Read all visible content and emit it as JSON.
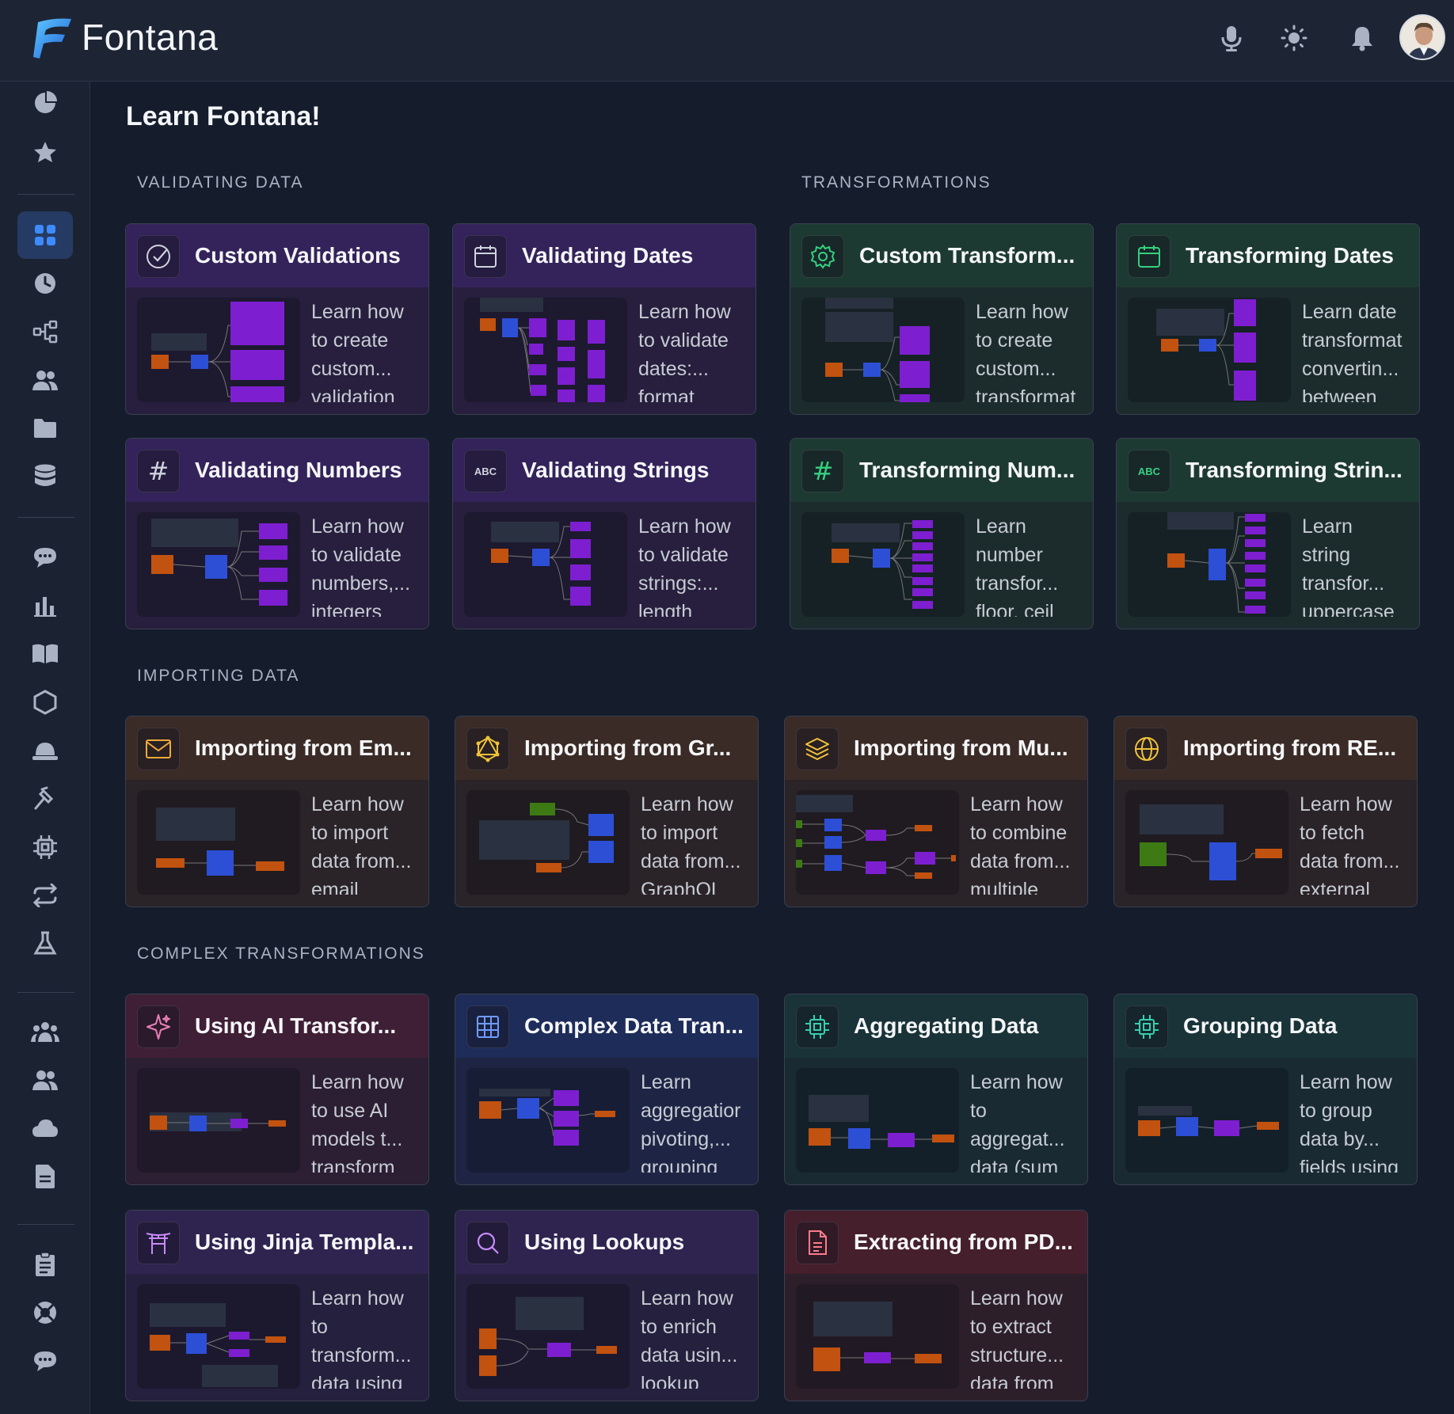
{
  "app": {
    "name": "Fontana"
  },
  "header": {
    "icons": [
      "microphone-icon",
      "sun-icon",
      "bell-icon",
      "avatar"
    ]
  },
  "sidebar": {
    "icons": [
      "pie-chart-icon",
      "star-icon",
      "grid-icon",
      "clock-icon",
      "flow-icon",
      "users-icon",
      "folder-icon",
      "database-icon",
      "chat-icon",
      "bar-chart-icon",
      "book-icon",
      "hexagon-icon",
      "hat-icon",
      "hammer-icon",
      "chip-icon",
      "repeat-icon",
      "flask-icon",
      "team-icon",
      "group-icon",
      "cloud-icon",
      "document-icon",
      "clipboard-icon",
      "support-icon",
      "message-icon"
    ],
    "active": "grid-icon"
  },
  "main": {
    "title": "Learn Fontana!",
    "sections": {
      "validating": "VALIDATING DATA",
      "transformations": "TRANSFORMATIONS",
      "importing": "IMPORTING DATA",
      "complex": "COMPLEX TRANSFORMATIONS"
    }
  },
  "cards": {
    "custom_validations": {
      "title": "Custom Validations",
      "icon": "check-circle-icon",
      "desc": [
        "Learn how",
        "to create",
        "custom...",
        "validation"
      ]
    },
    "validating_dates": {
      "title": "Validating Dates",
      "icon": "calendar-icon",
      "desc": [
        "Learn how",
        "to validate",
        "dates:...",
        "format"
      ]
    },
    "custom_transform": {
      "title": "Custom Transform...",
      "icon": "gear-icon",
      "desc": [
        "Learn how",
        "to create",
        "custom...",
        "transformat"
      ]
    },
    "transforming_dates": {
      "title": "Transforming Dates",
      "icon": "calendar-icon",
      "desc": [
        "Learn date",
        "transformat",
        "convertin...",
        "between"
      ]
    },
    "validating_numbers": {
      "title": "Validating Numbers",
      "icon": "hash-icon",
      "desc": [
        "Learn how",
        "to validate",
        "numbers,...",
        "integers"
      ]
    },
    "validating_strings": {
      "title": "Validating Strings",
      "icon": "abc-icon",
      "desc": [
        "Learn how",
        "to validate",
        "strings:...",
        "length"
      ]
    },
    "transforming_num": {
      "title": "Transforming Num...",
      "icon": "hash-icon",
      "desc": [
        "Learn",
        "number",
        "transfor...",
        "floor, ceil"
      ]
    },
    "transforming_strin": {
      "title": "Transforming Strin...",
      "icon": "abc-icon",
      "desc": [
        "Learn",
        "string",
        "transfor...",
        "uppercase"
      ]
    },
    "importing_em": {
      "title": "Importing from Em...",
      "icon": "mail-icon",
      "desc": [
        "Learn how",
        "to import",
        "data from...",
        "email"
      ]
    },
    "importing_gr": {
      "title": "Importing from Gr...",
      "icon": "graphql-icon",
      "desc": [
        "Learn how",
        "to import",
        "data from...",
        "GraphQL"
      ]
    },
    "importing_mu": {
      "title": "Importing from Mu...",
      "icon": "layers-icon",
      "desc": [
        "Learn how",
        "to combine",
        "data from...",
        "multiple"
      ]
    },
    "importing_re": {
      "title": "Importing from RE...",
      "icon": "globe-icon",
      "desc": [
        "Learn how",
        "to fetch",
        "data from...",
        "external"
      ]
    },
    "using_ai": {
      "title": "Using AI Transfor...",
      "icon": "sparkle-icon",
      "desc": [
        "Learn how",
        "to use AI",
        "models t...",
        "transform"
      ]
    },
    "complex_data": {
      "title": "Complex Data Tran...",
      "icon": "table-icon",
      "desc": [
        "Learn",
        "aggregatior",
        "pivoting,...",
        "grouping"
      ]
    },
    "aggregating": {
      "title": "Aggregating Data",
      "icon": "cpu-icon",
      "desc": [
        "Learn how",
        "to",
        "aggregat...",
        "data (sum"
      ]
    },
    "grouping": {
      "title": "Grouping Data",
      "icon": "cpu-icon",
      "desc": [
        "Learn how",
        "to group",
        "data by...",
        "fields using"
      ]
    },
    "jinja": {
      "title": "Using Jinja Templa...",
      "icon": "torii-icon",
      "desc": [
        "Learn how",
        "to",
        "transform...",
        "data using"
      ]
    },
    "lookups": {
      "title": "Using Lookups",
      "icon": "search-icon",
      "desc": [
        "Learn how",
        "to enrich",
        "data usin...",
        "lookup"
      ]
    },
    "pdf": {
      "title": "Extracting from PD...",
      "icon": "file-icon",
      "desc": [
        "Learn how",
        "to extract",
        "structure...",
        "data from"
      ]
    }
  },
  "colors": {
    "orange": "#c2520f",
    "blue": "#2d4fd6",
    "purple": "#7d1fd0",
    "green": "#3d7a14",
    "dark": "#2a3140"
  }
}
